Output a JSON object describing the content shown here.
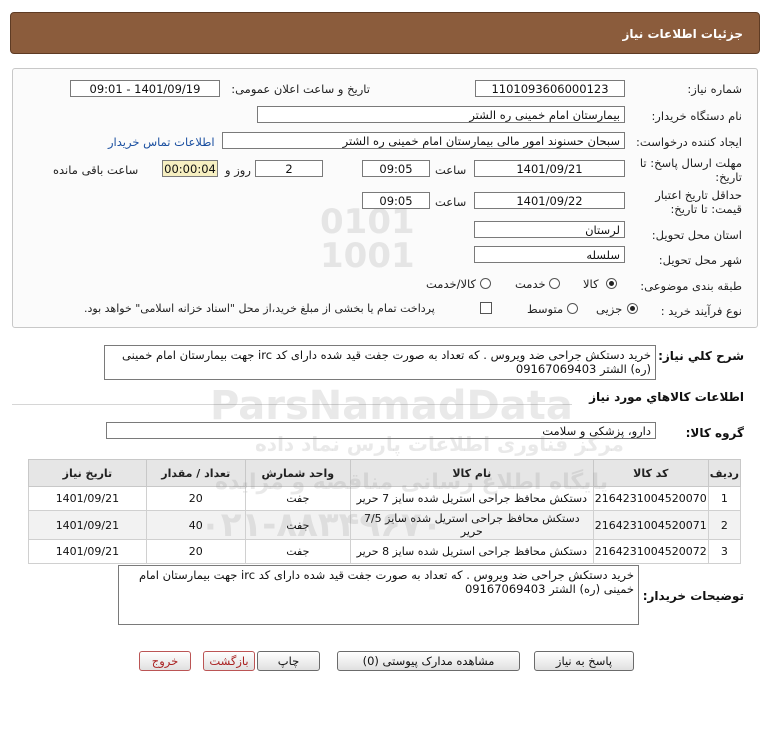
{
  "header": {
    "title": "جزئیات اطلاعات نیاز"
  },
  "form": {
    "need_number": {
      "label": "شماره نیاز:",
      "value": "1101093606000123"
    },
    "announce_datetime": {
      "label": "تاریخ و ساعت اعلان عمومی:",
      "value": "1401/09/19 - 09:01"
    },
    "buyer_org": {
      "label": "نام دستگاه خریدار:",
      "value": "بیمارستان امام خمینی ره الشتر"
    },
    "requester": {
      "label": "ایجاد کننده درخواست:",
      "value": "سبحان حسنوند امور مالی بیمارستان امام خمینی ره الشتر",
      "contact_link": "اطلاعات تماس خریدار"
    },
    "response_deadline": {
      "label_line1": "مهلت ارسال پاسخ: تا",
      "label_line2": "تاریخ:",
      "date": "1401/09/21",
      "time_label": "ساعت",
      "time": "09:05",
      "days": "2",
      "days_label": "روز و",
      "remaining": "00:00:04",
      "remaining_label": "ساعت باقی مانده"
    },
    "price_validity": {
      "label_line1": "حداقل تاریخ اعتبار",
      "label_line2": "قیمت: تا تاریخ:",
      "date": "1401/09/22",
      "time_label": "ساعت",
      "time": "09:05"
    },
    "province": {
      "label": "استان محل تحویل:",
      "value": "لرستان"
    },
    "city": {
      "label": "شهر محل تحویل:",
      "value": "سلسله"
    },
    "category": {
      "label": "طبقه بندی موضوعی:",
      "options": [
        "کالا",
        "خدمت",
        "کالا/خدمت"
      ],
      "selected": "کالا"
    },
    "purchase_type": {
      "label": "نوع فرآیند خرید :",
      "options": [
        "جزیی",
        "متوسط"
      ],
      "selected": "جزیی",
      "checkbox_text": "پرداخت تمام یا بخشی از مبلغ خرید،از محل \"اسناد خزانه اسلامی\" خواهد بود."
    }
  },
  "general_description": {
    "label": "شرح كلي نياز:",
    "text": "خرید دستکش جراحی ضد ویروس . که تعداد به صورت جفت قید شده دارای کد irc جهت بیمارستان امام خمینی (ره) الشتر 09167069403"
  },
  "goods_info_title": "اطلاعات كالاهاي مورد نياز",
  "goods_group": {
    "label": "گروه کالا:",
    "value": "دارو، پزشکی و سلامت"
  },
  "items_table": {
    "headers": [
      "ردیف",
      "کد کالا",
      "نام کالا",
      "واحد شمارش",
      "تعداد / مقدار",
      "تاریخ نیاز"
    ],
    "rows": [
      {
        "row": "1",
        "code": "2164231004520070",
        "name": "دستکش محافظ جراحی استریل شده سایز 7 حریر",
        "unit": "جفت",
        "qty": "20",
        "date": "1401/09/21"
      },
      {
        "row": "2",
        "code": "2164231004520071",
        "name": "دستکش محافظ جراحی استریل شده سایز 7/5 حریر",
        "unit": "جفت",
        "qty": "40",
        "date": "1401/09/21"
      },
      {
        "row": "3",
        "code": "2164231004520072",
        "name": "دستکش محافظ جراحی استریل شده سایز 8 حریر",
        "unit": "جفت",
        "qty": "20",
        "date": "1401/09/21"
      }
    ]
  },
  "buyer_notes": {
    "label": "توضیحات خریدار:",
    "text": "خرید دستکش جراحی ضد ویروس . که تعداد به صورت جفت قید شده دارای کد irc جهت بیمارستان امام خمینی (ره) الشتر 09167069403"
  },
  "buttons": {
    "reply": "پاسخ به نیاز",
    "attachments": "مشاهده مدارک پیوستی (0)",
    "print": "چاپ",
    "back": "بازگشت",
    "exit": "خروج"
  },
  "watermark": {
    "brand": "ParsNamadData",
    "line1": "پایگاه اطلاع رسانی مناقصه و مزایده",
    "line2": "مرکز فناوری اطلاعات پارس نماد داده",
    "phone": "۰۲۱-۸۸۳۴۹۶۷۰"
  }
}
